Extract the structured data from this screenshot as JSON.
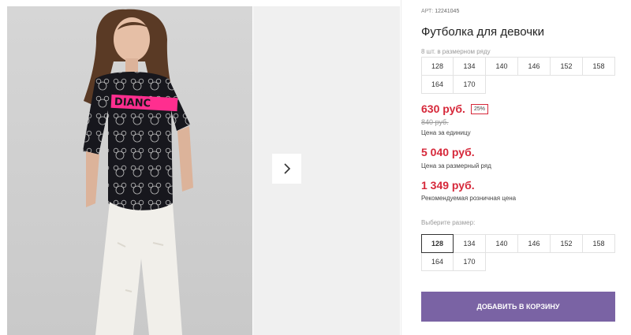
{
  "product": {
    "article_label": "АРТ:",
    "article_number": "12241045",
    "title": "Футболка для девочки"
  },
  "pack": {
    "note": "8 шт. в размерном ряду",
    "sizes": [
      "128",
      "134",
      "140",
      "146",
      "152",
      "158",
      "164",
      "170"
    ]
  },
  "prices": {
    "unit_price": "630 руб.",
    "discount_badge": "25%",
    "old_price": "840 руб.",
    "unit_caption": "Цена за единицу",
    "pack_price": "5 040 руб.",
    "pack_caption": "Цена за размерный ряд",
    "retail_price": "1 349 руб.",
    "retail_caption": "Рекомендуемая розничная цена"
  },
  "size_picker": {
    "label": "Выберите размер:",
    "selected": "128",
    "sizes": [
      "128",
      "134",
      "140",
      "146",
      "152",
      "158",
      "164",
      "170"
    ]
  },
  "actions": {
    "add_to_cart": "ДОБАВИТЬ В КОРЗИНУ"
  },
  "gallery": {
    "next_icon": "chevron-right-icon",
    "shirt_print_text": "DIANC"
  },
  "colors": {
    "price_red": "#d6283a",
    "button_purple": "#7a63a4"
  }
}
